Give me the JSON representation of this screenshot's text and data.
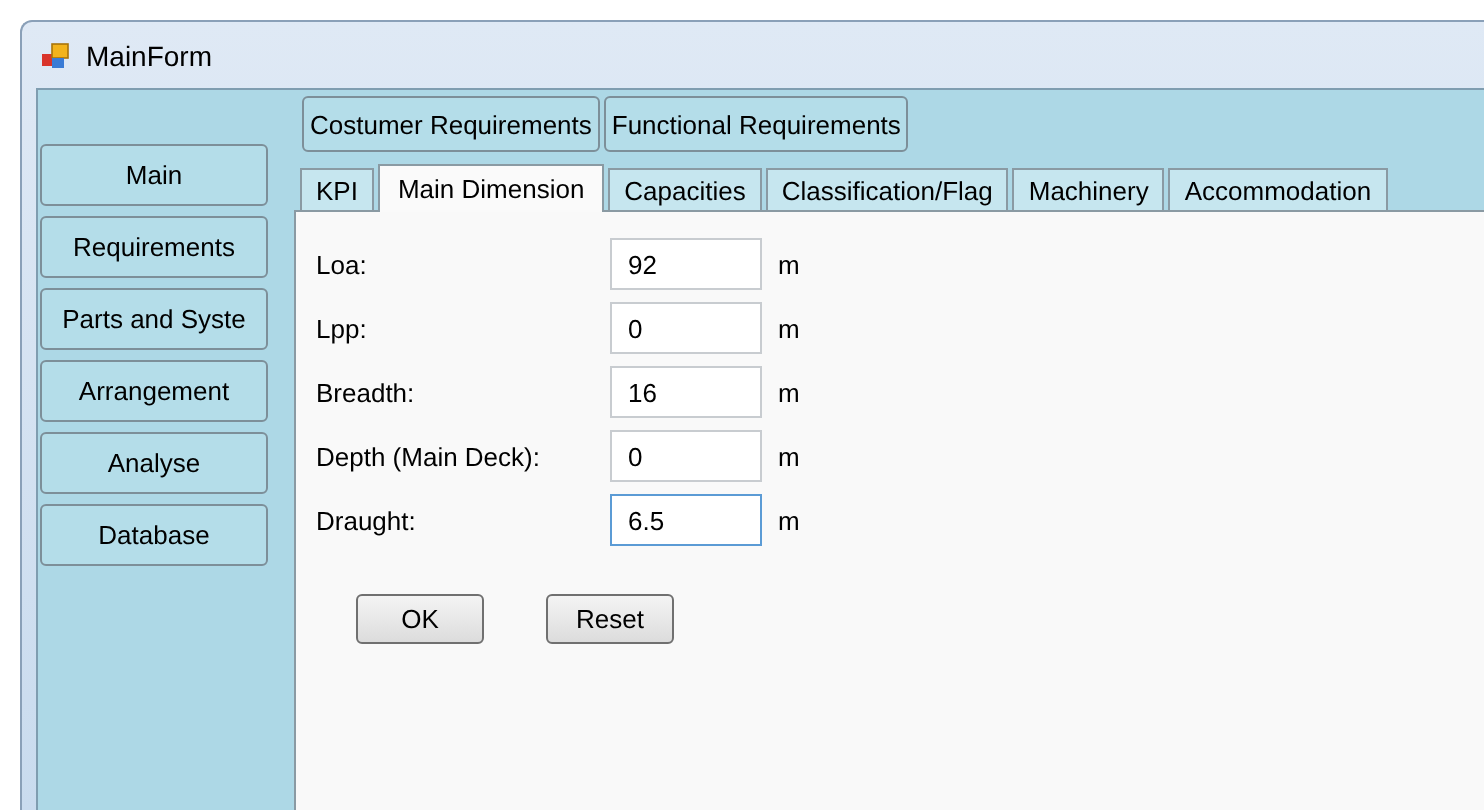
{
  "window": {
    "title": "MainForm"
  },
  "nav_buttons": [
    {
      "label": "Main"
    },
    {
      "label": "Requirements"
    },
    {
      "label": "Parts and Syste"
    },
    {
      "label": "Arrangement"
    },
    {
      "label": "Analyse"
    },
    {
      "label": "Database"
    }
  ],
  "top_buttons": [
    {
      "label": "Costumer Requirements"
    },
    {
      "label": "Functional Requirements"
    }
  ],
  "tabs": [
    {
      "label": "KPI",
      "selected": false
    },
    {
      "label": "Main Dimension",
      "selected": true
    },
    {
      "label": "Capacities",
      "selected": false
    },
    {
      "label": "Classification/Flag",
      "selected": false
    },
    {
      "label": "Machinery",
      "selected": false
    },
    {
      "label": "Accommodation",
      "selected": false
    }
  ],
  "fields": [
    {
      "label": "Loa:",
      "value": "92",
      "unit": "m",
      "focused": false
    },
    {
      "label": "Lpp:",
      "value": "0",
      "unit": "m",
      "focused": false
    },
    {
      "label": "Breadth:",
      "value": "16",
      "unit": "m",
      "focused": false
    },
    {
      "label": "Depth (Main Deck):",
      "value": "0",
      "unit": "m",
      "focused": false
    },
    {
      "label": "Draught:",
      "value": "6.5",
      "unit": "m",
      "focused": true
    }
  ],
  "buttons": [
    {
      "label": "OK"
    },
    {
      "label": "Reset"
    }
  ]
}
